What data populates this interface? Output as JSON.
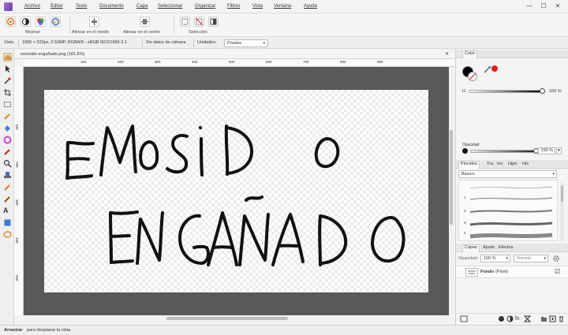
{
  "menu": [
    "Archivo",
    "Editar",
    "Texto",
    "Documento",
    "Capa",
    "Seleccionar",
    "Organizar",
    "Filtros",
    "Vista",
    "Ventana",
    "Ayuda"
  ],
  "window_controls": {
    "minimize": "—",
    "maximize": "☐",
    "close": "✕"
  },
  "toolbar": {
    "enhance_label": "Mejorar",
    "align_middle_label": "Alinear en el medio",
    "align_center_label": "Alinear en el centro",
    "selection_label": "Selección"
  },
  "context": {
    "view_label": "Vista",
    "image_info": "1000 × 533px, 0.53MP, RGBA/8 - sRGB IEC61966-2.1",
    "camera_info": "Sin datos de cámara",
    "units_label": "Unidades:",
    "units_value": "Píxeles"
  },
  "document": {
    "tab_title": "emosido engañado.png (181.8%)",
    "close_label": "✕"
  },
  "ruler_ticks": [
    "100",
    "200",
    "300",
    "400",
    "500",
    "600",
    "700",
    "800",
    "900"
  ],
  "vruler_ticks": [
    "100",
    "200",
    "300",
    "400",
    "500"
  ],
  "canvas_text": {
    "line1": "EMOSIDO",
    "line2": "ENGAÑADO"
  },
  "color_panel": {
    "tab": "Color",
    "h_label": "H",
    "h_value": "100 %",
    "opacity_label": "Opacidad",
    "opacity_value": "100 %",
    "accent_red": "#e0201c"
  },
  "brushes_panel": {
    "tabs": [
      "Pinceles",
      "Tra",
      "Inv",
      "Hgm",
      "His"
    ],
    "category": "Básico",
    "stroke_sizes": [
      "1",
      "2",
      "3",
      "4"
    ]
  },
  "layers_panel": {
    "tabs": [
      "Capas",
      "Ajuste",
      "Efectos"
    ],
    "opacity_label": "Opacidad:",
    "opacity_value": "100 %",
    "blend_mode": "Normal",
    "layers": [
      {
        "name": "Fondo",
        "kind": "(Píxel)",
        "visible": "☑"
      }
    ]
  },
  "status": {
    "bold": "Arrastrar",
    "text": "para desplazar la vista."
  }
}
